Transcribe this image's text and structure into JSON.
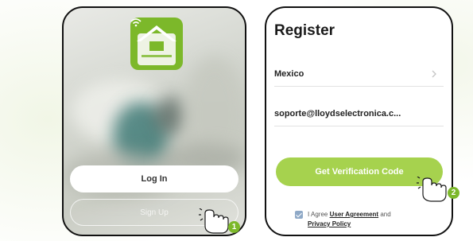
{
  "login_screen": {
    "login_label": "Log In",
    "signup_label": "Sign Up"
  },
  "register_screen": {
    "title": "Register",
    "country": "Mexico",
    "email": "soporte@lloydselectronica.c...",
    "verify_label": "Get Verification Code",
    "agree_prefix": "I Agree",
    "user_agreement": "User Agreement",
    "and_text": "and",
    "privacy_policy": "Privacy Policy"
  },
  "steps": {
    "step_1": "1",
    "step_2": "2"
  },
  "colors": {
    "brand_green": "#7cb82a",
    "button_green": "#a6d24e",
    "checkbox_blue": "#8fa9c7"
  },
  "icons": [
    "app-logo-icon",
    "wifi-icon",
    "chevron-right-icon",
    "checkbox-icon",
    "tap-hand-icon"
  ]
}
